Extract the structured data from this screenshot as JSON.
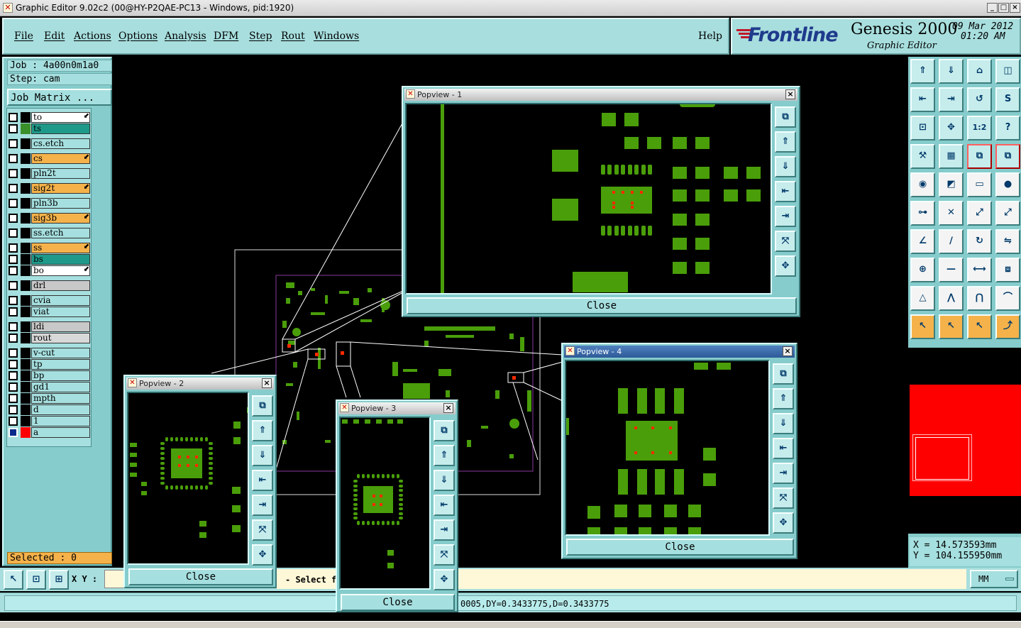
{
  "window": {
    "title": "Graphic Editor 9.02c2 (00@HY-P2QAE-PC13 - Windows, pid:1920)"
  },
  "menu": {
    "items": [
      "File",
      "Edit",
      "Actions",
      "Options",
      "Analysis",
      "DFM",
      "Step",
      "Rout",
      "Windows"
    ],
    "help": "Help"
  },
  "brand": {
    "logo": "Frontline",
    "product": "Genesis 2000",
    "subtitle": "Graphic Editor",
    "date": "09 Mar 2012",
    "time": "01:20 AM"
  },
  "job": {
    "job_label": "Job : 4a00n0m1a0",
    "step_label": "Step: cam",
    "matrix_button": "Job Matrix ..."
  },
  "layers": [
    {
      "name": "to",
      "bg": "#ffffff",
      "swatch": "#000000",
      "arrow": true
    },
    {
      "name": "ts",
      "bg": "#1f9a8a",
      "swatch": "#3a8f2a",
      "arrow": false
    },
    {
      "name": "cs.etch",
      "bg": "#a6dfdf",
      "swatch": "#000000",
      "arrow": false
    },
    {
      "name": "cs",
      "bg": "#f5b24a",
      "swatch": "#000000",
      "arrow": true
    },
    {
      "name": "pln2t",
      "bg": "#a6dfdf",
      "swatch": "#000000",
      "arrow": false
    },
    {
      "name": "sig2t",
      "bg": "#f5b24a",
      "swatch": "#000000",
      "arrow": true
    },
    {
      "name": "pln3b",
      "bg": "#a6dfdf",
      "swatch": "#000000",
      "arrow": false
    },
    {
      "name": "sig3b",
      "bg": "#f5b24a",
      "swatch": "#000000",
      "arrow": true
    },
    {
      "name": "ss.etch",
      "bg": "#a6dfdf",
      "swatch": "#000000",
      "arrow": false
    },
    {
      "name": "ss",
      "bg": "#f5b24a",
      "swatch": "#000000",
      "arrow": true
    },
    {
      "name": "bs",
      "bg": "#1f9a8a",
      "swatch": "#000000",
      "arrow": false
    },
    {
      "name": "bo",
      "bg": "#ffffff",
      "swatch": "#000000",
      "arrow": true
    },
    {
      "name": "drl",
      "bg": "#c8c8c8",
      "swatch": "#000000",
      "arrow": false
    },
    {
      "name": "cvia",
      "bg": "#a6dfdf",
      "swatch": "#000000",
      "arrow": false
    },
    {
      "name": "viat",
      "bg": "#a6dfdf",
      "swatch": "#000000",
      "arrow": false
    },
    {
      "name": "ldi",
      "bg": "#c8c8c8",
      "swatch": "#000000",
      "arrow": false
    },
    {
      "name": "rout",
      "bg": "#d8d8d8",
      "swatch": "#000000",
      "arrow": false
    },
    {
      "name": "v-cut",
      "bg": "#a6dfdf",
      "swatch": "#000000",
      "arrow": false
    },
    {
      "name": "tp",
      "bg": "#a6dfdf",
      "swatch": "#000000",
      "arrow": false
    },
    {
      "name": "bp",
      "bg": "#a6dfdf",
      "swatch": "#000000",
      "arrow": false
    },
    {
      "name": "gd1",
      "bg": "#a6dfdf",
      "swatch": "#000000",
      "arrow": false
    },
    {
      "name": "mpth",
      "bg": "#a6dfdf",
      "swatch": "#000000",
      "arrow": false
    },
    {
      "name": "d",
      "bg": "#a6dfdf",
      "swatch": "#000000",
      "arrow": false
    },
    {
      "name": "1",
      "bg": "#a6dfdf",
      "swatch": "#000000",
      "arrow": false
    },
    {
      "name": "a",
      "bg": "#a6dfdf",
      "swatch": "#ff0000",
      "arrow": false
    }
  ],
  "selected": "Selected : 0",
  "popviews": [
    {
      "title": "Popview - 1",
      "close": "Close"
    },
    {
      "title": "Popview - 2",
      "close": "Close"
    },
    {
      "title": "Popview - 3",
      "close": "Close"
    },
    {
      "title": "Popview - 4",
      "close": "Close"
    }
  ],
  "status": {
    "xy_label": "X Y :",
    "prompt": "- Select fir",
    "measure": "0005,DY=0.3433775,D=0.3433775",
    "units": "MM"
  },
  "coords": {
    "x": "X  =  14.573593mm",
    "y": "Y  = 104.155950mm"
  },
  "colors": {
    "panel": "#86cccc",
    "pad": "#4a9e0a",
    "highlight": "#ff0000",
    "selected_bar": "#f5b24a"
  }
}
